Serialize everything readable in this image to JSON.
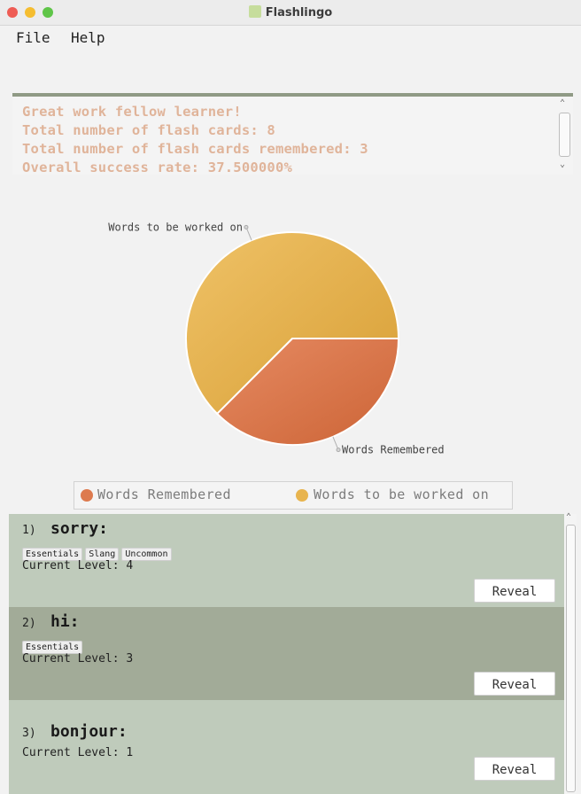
{
  "window": {
    "title": "Flashlingo"
  },
  "menu": {
    "file": "File",
    "help": "Help"
  },
  "result": {
    "line1": "Great work fellow learner!",
    "line2": "Total number of flash cards: 8",
    "line3": "Total number of flash cards remembered: 3",
    "line4": "Overall success rate: 37.500000%"
  },
  "colors": {
    "remembered": "#dd7a4e",
    "to_work_on": "#e8b44e",
    "card_bg_light": "#bfcbbb",
    "card_bg_dark": "#a2ab98"
  },
  "chart_data": {
    "type": "pie",
    "labels": [
      "Words Remembered",
      "Words to be worked on"
    ],
    "values": [
      3,
      5
    ],
    "legend": [
      "Words Remembered",
      "Words to be worked on"
    ],
    "legend_position": "bottom"
  },
  "cards": [
    {
      "index": "1)",
      "word": "sorry:",
      "tags": [
        "Essentials",
        "Slang",
        "Uncommon"
      ],
      "level": "Current Level: 4",
      "reveal": "Reveal"
    },
    {
      "index": "2)",
      "word": "hi:",
      "tags": [
        "Essentials"
      ],
      "level": "Current Level: 3",
      "reveal": "Reveal"
    },
    {
      "index": "3)",
      "word": "bonjour:",
      "tags": [],
      "level": "Current Level: 1",
      "reveal": "Reveal"
    }
  ]
}
